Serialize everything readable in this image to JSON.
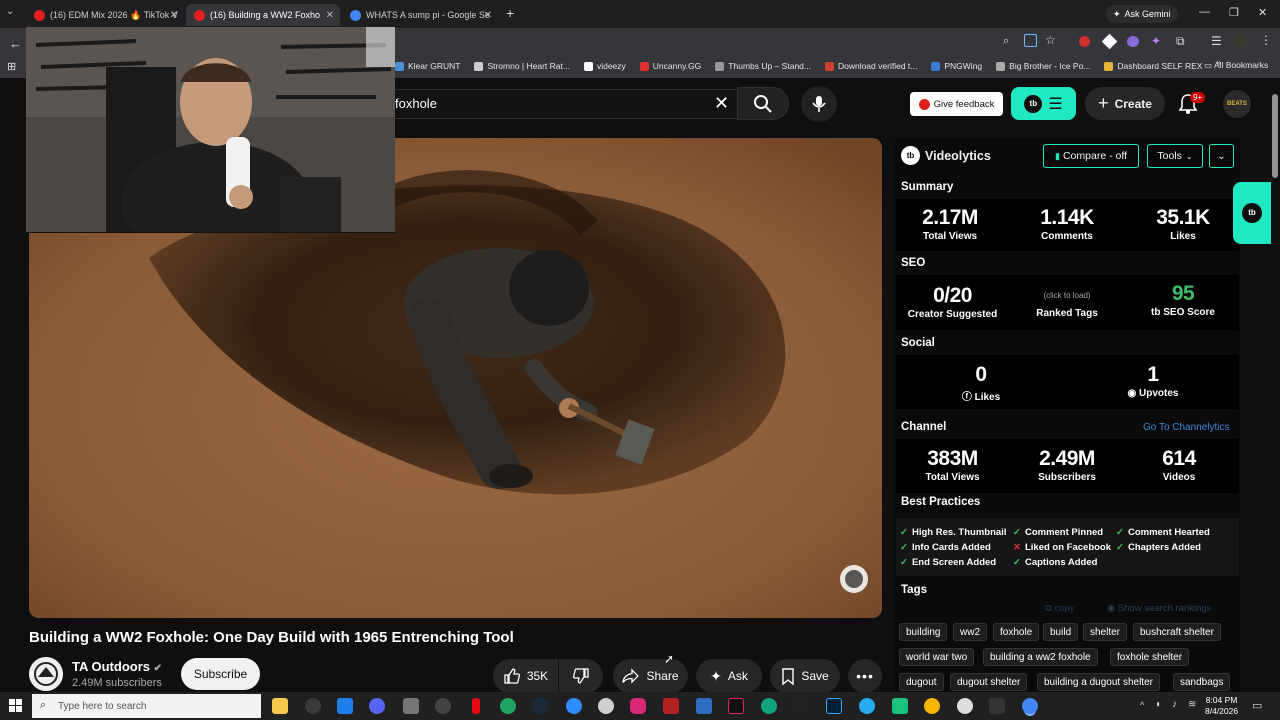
{
  "browser": {
    "tabs": [
      {
        "title": "(16) EDM Mix 2026 🔥 TikTok V",
        "active": false
      },
      {
        "title": "(16) Building a WW2 Foxho",
        "active": true
      },
      {
        "title": "WHATS A sump pi - Google Se",
        "active": false
      }
    ],
    "new_tab": "+",
    "gemini_label": "Ask Gemini",
    "bookmarks": [
      {
        "label": "Klear GRUNT",
        "color": "#4a90d9"
      },
      {
        "label": "Stromno | Heart Rat...",
        "color": "#cccccc"
      },
      {
        "label": "videezy",
        "color": "#ffffff"
      },
      {
        "label": "Uncanny.GG",
        "color": "#e03030"
      },
      {
        "label": "Thumbs Up – Stand...",
        "color": "#999999"
      },
      {
        "label": "Download verified t...",
        "color": "#d04030"
      },
      {
        "label": "PNGWing",
        "color": "#3a7bd5"
      },
      {
        "label": "Big Brother - Ice Po...",
        "color": "#aaaaaa"
      },
      {
        "label": "Dashboard SELF REX",
        "color": "#e8b33a"
      }
    ],
    "all_bookmarks": "All Bookmarks"
  },
  "youtube": {
    "search_value": "foxhole",
    "feedback_label": "Give feedback",
    "create_label": "Create",
    "notif_badge": "9+",
    "avatar_text": "BEATS",
    "video_title": "Building a WW2 Foxhole: One Day Build with 1965 Entrenching Tool",
    "channel_name": "TA Outdoors",
    "channel_subs": "2.49M subscribers",
    "subscribe_label": "Subscribe",
    "like_count": "35K",
    "share_label": "Share",
    "ask_label": "Ask",
    "save_label": "Save"
  },
  "videolytics": {
    "brand": "Videolytics",
    "compare_label": "Compare - off",
    "tools_label": "Tools",
    "summary": {
      "title": "Summary",
      "stats": [
        {
          "value": "2.17M",
          "label": "Total Views"
        },
        {
          "value": "1.14K",
          "label": "Comments"
        },
        {
          "value": "35.1K",
          "label": "Likes"
        }
      ]
    },
    "seo": {
      "title": "SEO",
      "creator_value": "0/20",
      "creator_label": "Creator Suggested",
      "ranked_hint": "(click to load)",
      "ranked_label": "Ranked Tags",
      "score_value": "95",
      "score_label": "SEO Score"
    },
    "social": {
      "title": "Social",
      "likes_value": "0",
      "likes_label": "Likes",
      "upvotes_value": "1",
      "upvotes_label": "Upvotes"
    },
    "channel": {
      "title": "Channel",
      "link": "Go To Channelytics",
      "stats": [
        {
          "value": "383M",
          "label": "Total Views"
        },
        {
          "value": "2.49M",
          "label": "Subscribers"
        },
        {
          "value": "614",
          "label": "Videos"
        }
      ]
    },
    "best_practices": {
      "title": "Best Practices",
      "items": [
        {
          "label": "High Res. Thumbnail",
          "ok": true
        },
        {
          "label": "Comment Pinned",
          "ok": true
        },
        {
          "label": "Comment Hearted",
          "ok": true
        },
        {
          "label": "Info Cards Added",
          "ok": true
        },
        {
          "label": "Liked on Facebook",
          "ok": false
        },
        {
          "label": "Chapters Added",
          "ok": true
        },
        {
          "label": "End Screen Added",
          "ok": true
        },
        {
          "label": "Captions Added",
          "ok": true
        }
      ]
    },
    "tags": {
      "title": "Tags",
      "copy_label": "copy",
      "show_rankings": "Show search rankings",
      "items": [
        "building",
        "ww2",
        "foxhole",
        "build",
        "shelter",
        "bushcraft shelter",
        "world war two",
        "building a ww2 foxhole",
        "foxhole shelter",
        "dugout",
        "dugout shelter",
        "building a dugout shelter",
        "sandbags"
      ]
    }
  },
  "taskbar": {
    "search_placeholder": "Type here to search",
    "time": "8:04 PM",
    "date": "8/4/2026"
  }
}
